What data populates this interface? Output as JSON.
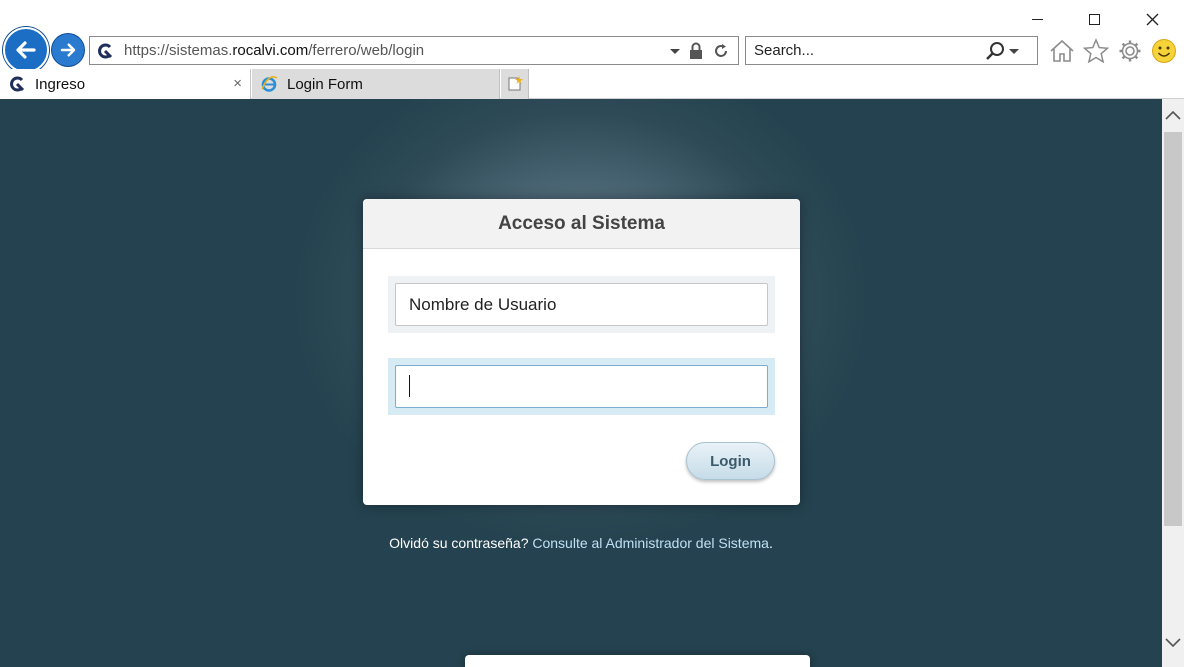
{
  "browser": {
    "address": {
      "url_prefix": "https://sistemas.",
      "url_domain": "rocalvi.com",
      "url_path": "/ferrero/web/login"
    },
    "search": {
      "placeholder": "Search..."
    },
    "tabs": [
      {
        "label": "Ingreso",
        "close": "×",
        "active": true,
        "icon": "rocalvi-favicon-icon"
      },
      {
        "label": "Login Form",
        "active": false,
        "icon": "ie-icon"
      }
    ]
  },
  "login": {
    "title": "Acceso al Sistema",
    "username_placeholder": "Nombre de Usuario",
    "password_value": "",
    "button_label": "Login",
    "forgot_text": "Olvidó su contraseña?",
    "forgot_link": "Consulte al Administrador del Sistema",
    "forgot_suffix": "."
  },
  "colors": {
    "page_background": "#24424f",
    "nav_blue": "#1b6ec4",
    "link": "#bfe0f2"
  }
}
